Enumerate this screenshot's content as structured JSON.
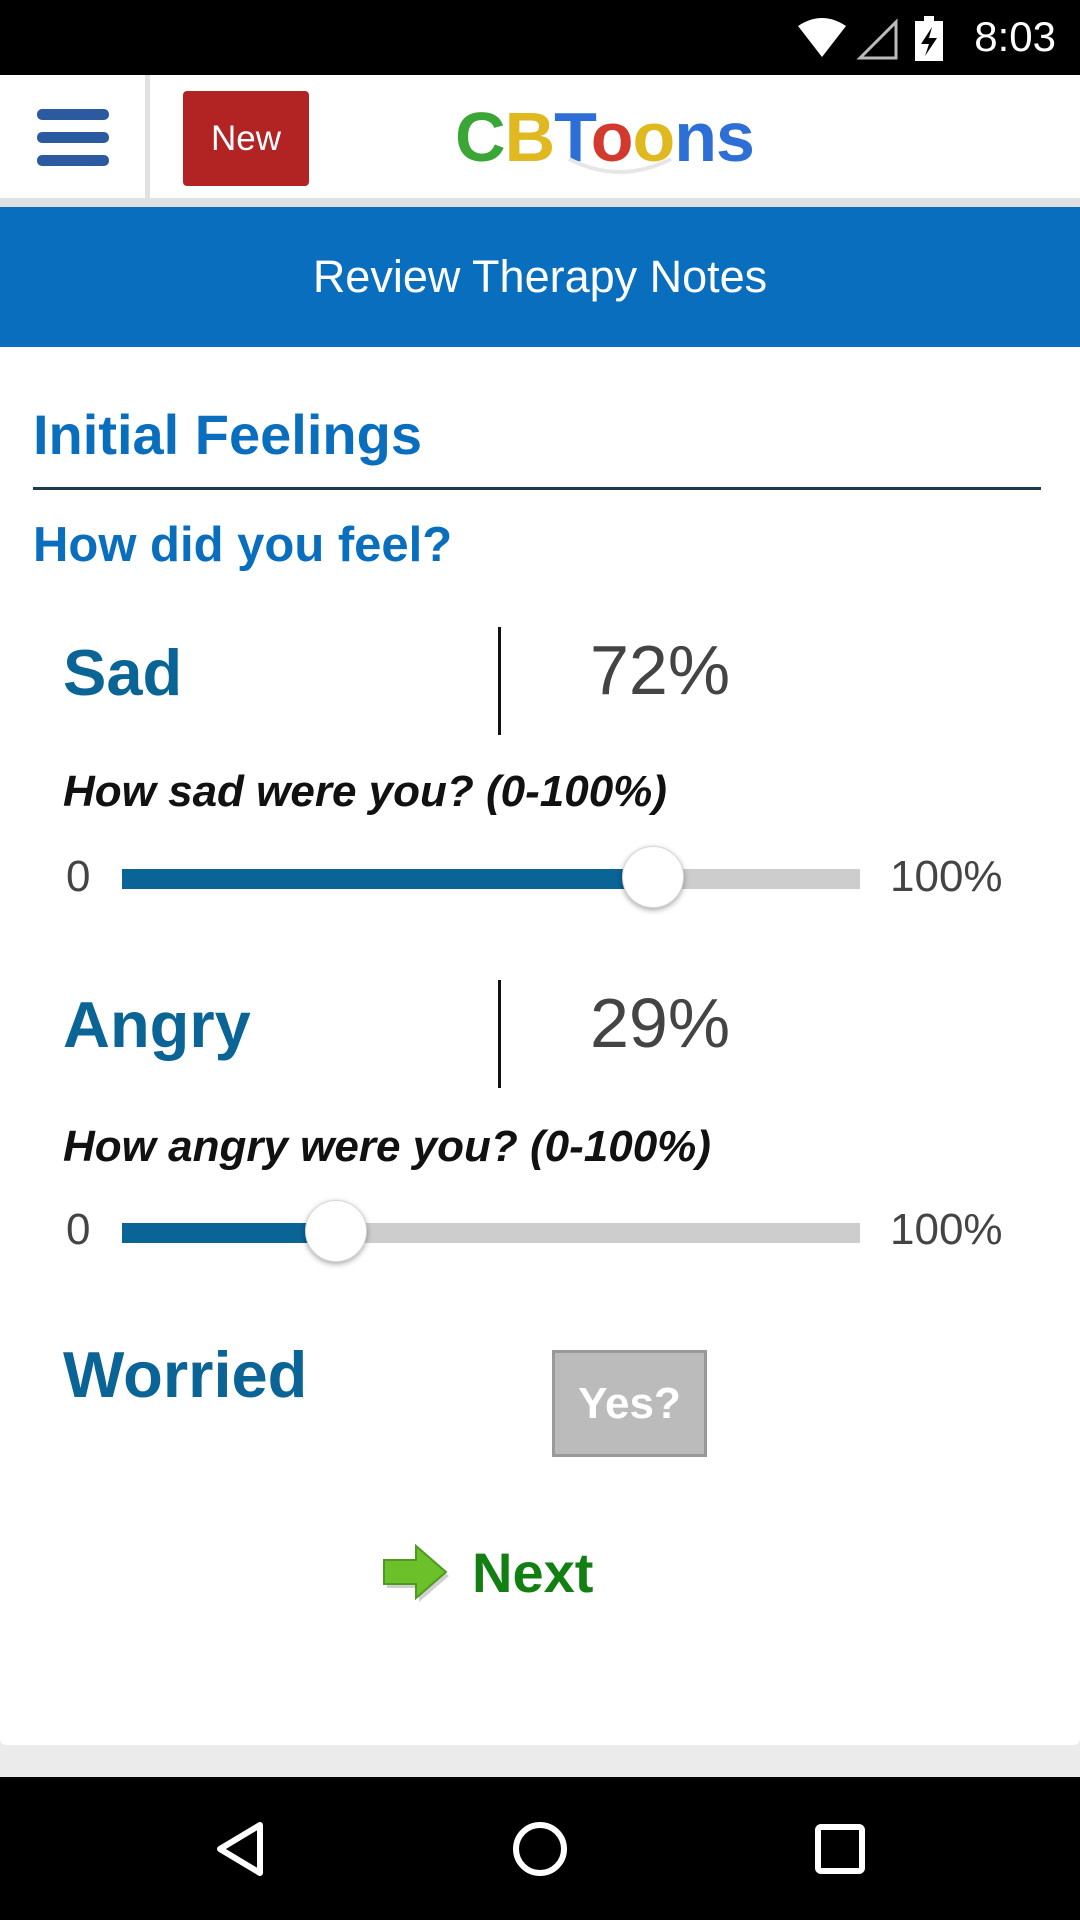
{
  "status_bar": {
    "time": "8:03",
    "icons": [
      "wifi-icon",
      "signal-icon",
      "battery-charging-icon"
    ]
  },
  "header": {
    "new_label": "New",
    "logo_letters": [
      {
        "char": "C",
        "color": "#3aa636"
      },
      {
        "char": "B",
        "color": "#e0b820"
      },
      {
        "char": "T",
        "color": "#2d6fd6"
      },
      {
        "char": "o",
        "color": "#d23a2e"
      },
      {
        "char": "o",
        "color": "#e0b820"
      },
      {
        "char": "n",
        "color": "#2d6fd6"
      },
      {
        "char": "s",
        "color": "#2d6fd6"
      }
    ]
  },
  "title_band": {
    "title": "Review Therapy Notes"
  },
  "section": {
    "title": "Initial Feelings",
    "question": "How did you feel?"
  },
  "feelings": [
    {
      "name": "Sad",
      "value_label": "72%",
      "prompt": "How sad were you? (0-100%)",
      "min_label": "0",
      "max_label": "100%",
      "value": 72
    },
    {
      "name": "Angry",
      "value_label": "29%",
      "prompt": "How angry were you? (0-100%)",
      "min_label": "0",
      "max_label": "100%",
      "value": 29
    },
    {
      "name": "Worried",
      "button_label": "Yes?"
    }
  ],
  "next": {
    "label": "Next"
  },
  "colors": {
    "accent_blue": "#0a6ebe",
    "slider_fill": "#0a6496",
    "new_button": "#b22424",
    "next_green": "#127f12"
  }
}
